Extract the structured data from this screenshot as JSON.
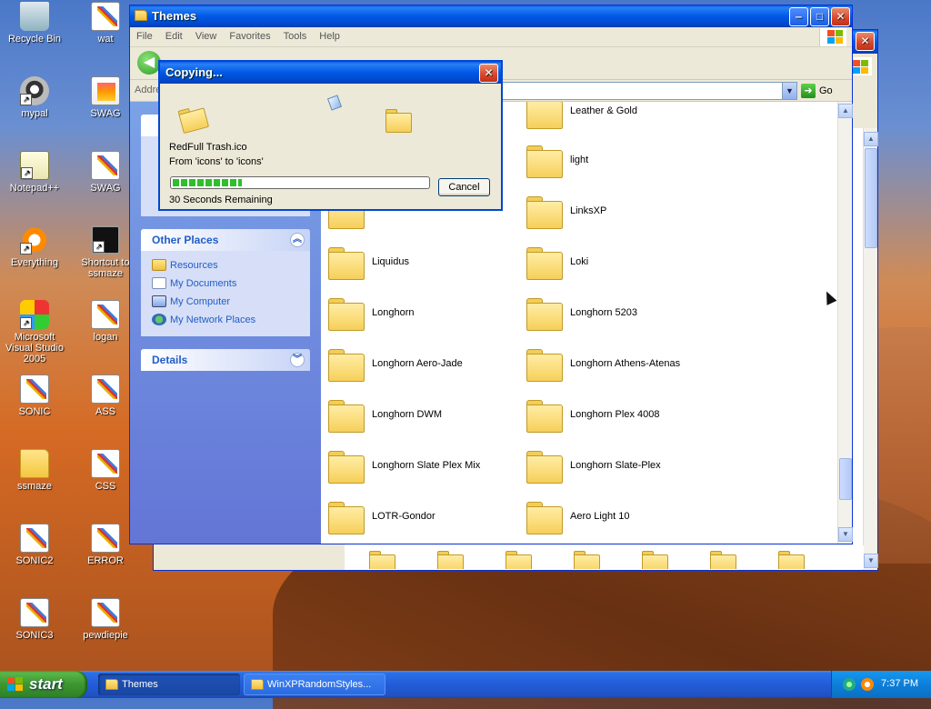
{
  "desktop": {
    "icons": [
      {
        "label": "Recycle Bin",
        "icon": "recycle-bin-icon"
      },
      {
        "label": "wat",
        "icon": "paint-file-icon"
      },
      {
        "label": "mypal",
        "icon": "mypal-icon"
      },
      {
        "label": "SWAG",
        "icon": "image-file-icon"
      },
      {
        "label": "Notepad++",
        "icon": "notepad-icon"
      },
      {
        "label": "SWAG",
        "icon": "paint-file-icon"
      },
      {
        "label": "Everything",
        "icon": "everything-icon"
      },
      {
        "label": "Shortcut to ssmaze",
        "icon": "terminal-icon"
      },
      {
        "label": "Microsoft Visual Studio 2005",
        "icon": "visual-studio-icon"
      },
      {
        "label": "logan",
        "icon": "paint-file-icon"
      },
      {
        "label": "SONIC",
        "icon": "paint-file-icon"
      },
      {
        "label": "ASS",
        "icon": "paint-file-icon"
      },
      {
        "label": "ssmaze",
        "icon": "folder-icon"
      },
      {
        "label": "CSS",
        "icon": "paint-file-icon"
      },
      {
        "label": "SONIC2",
        "icon": "paint-file-icon"
      },
      {
        "label": "ERROR",
        "icon": "paint-file-icon"
      },
      {
        "label": "SONIC3",
        "icon": "paint-file-icon"
      },
      {
        "label": "pewdiepie",
        "icon": "paint-file-icon"
      }
    ]
  },
  "explorer": {
    "title": "Themes",
    "menu": [
      "File",
      "Edit",
      "View",
      "Favorites",
      "Tools",
      "Help"
    ],
    "address_label": "Address",
    "go_label": "Go",
    "other_places": {
      "title": "Other Places",
      "items": [
        "Resources",
        "My Documents",
        "My Computer",
        "My Network Places"
      ]
    },
    "details": {
      "title": "Details"
    },
    "folders": [
      "Leather & Gold",
      "light",
      "LinksXP",
      "Liquidus",
      "Loki",
      "Longhorn",
      "Longhorn 5203",
      "Longhorn Aero-Jade",
      "Longhorn Athens-Atenas",
      "Longhorn DWM",
      "Longhorn Plex 4008",
      "Longhorn Slate Plex Mix",
      "Longhorn Slate-Plex",
      "LOTR-Gondor",
      "Aero Light 10"
    ]
  },
  "copy_dialog": {
    "title": "Copying...",
    "file_name": "RedFull Trash.ico",
    "from_to": "From 'icons' to 'icons'",
    "remaining": "30 Seconds Remaining",
    "progress_fraction": 0.27,
    "cancel_label": "Cancel"
  },
  "taskbar": {
    "start_label": "start",
    "tasks": [
      {
        "label": "Themes",
        "active": true
      },
      {
        "label": "WinXPRandomStyles...",
        "active": false
      }
    ],
    "clock": "7:37 PM"
  }
}
